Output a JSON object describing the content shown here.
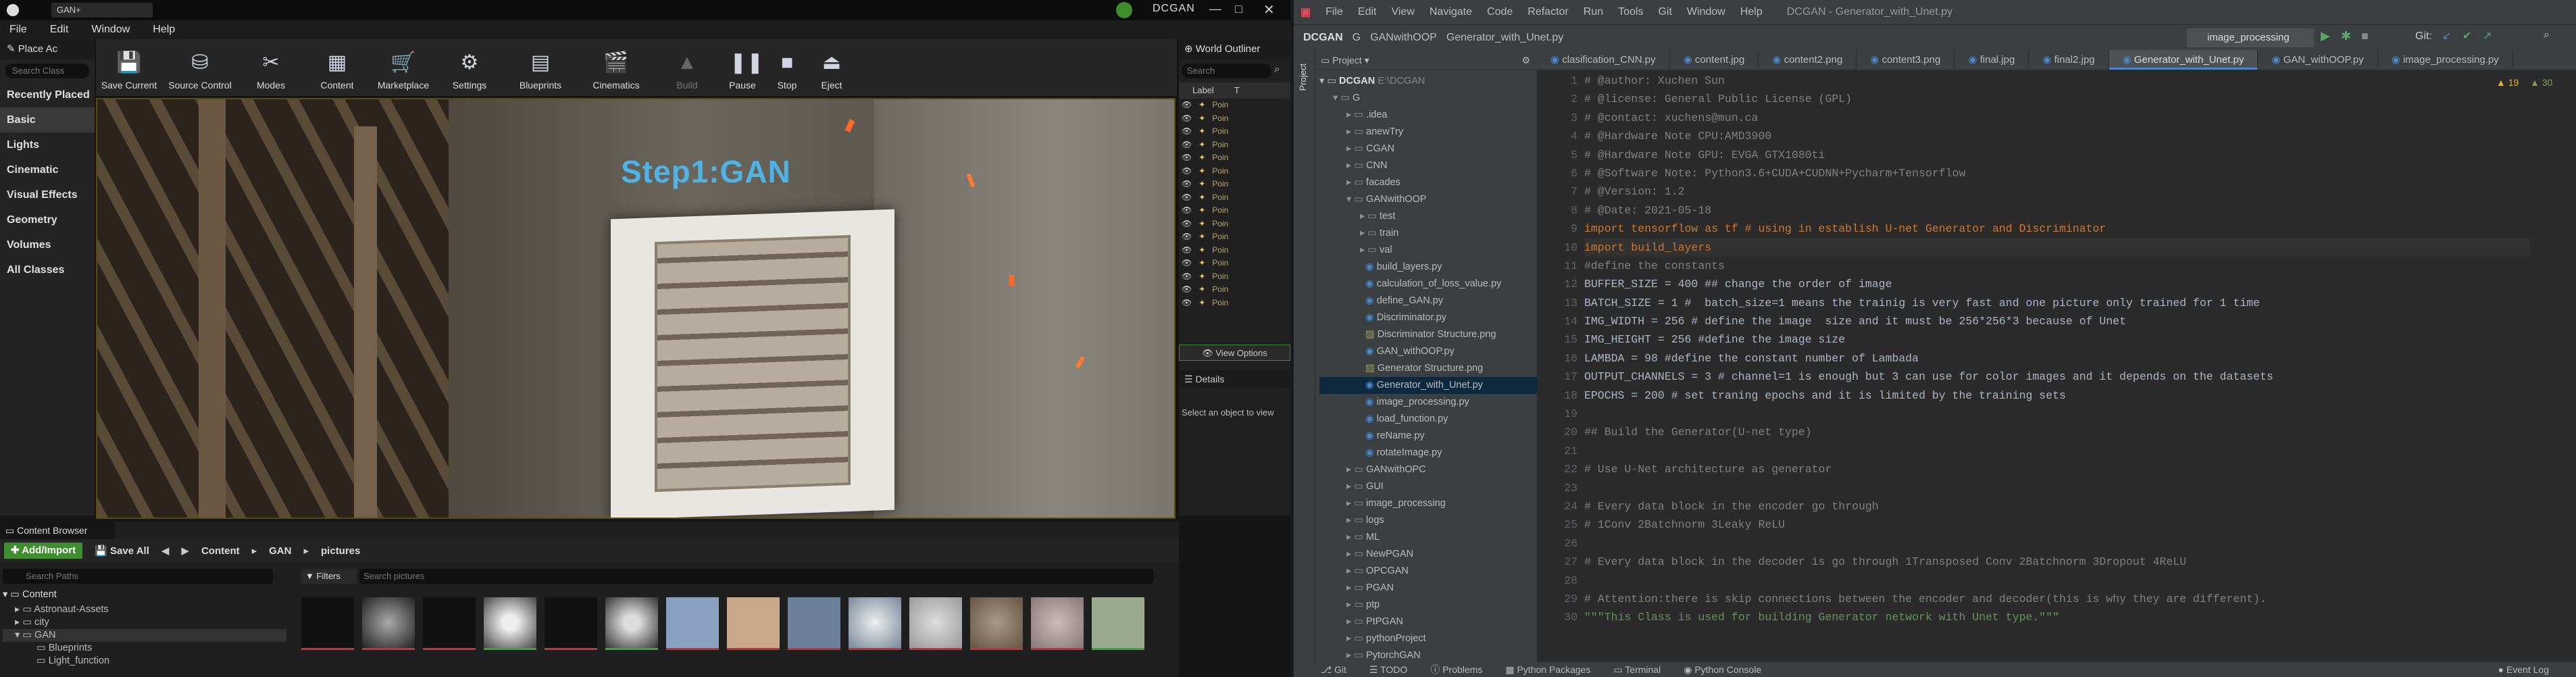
{
  "ue": {
    "window_title": "GAN+",
    "brand": "DCGAN",
    "menu": [
      "File",
      "Edit",
      "Window",
      "Help"
    ],
    "place_actors": "Place Ac",
    "search_classes": "Search Class",
    "categories": [
      "Recently Placed",
      "Basic",
      "Lights",
      "Cinematic",
      "Visual Effects",
      "Geometry",
      "Volumes",
      "All Classes"
    ],
    "toolbar": [
      "Save Current",
      "Source Control",
      "Modes",
      "Content",
      "Marketplace",
      "Settings",
      "Blueprints",
      "Cinematics",
      "Build",
      "Pause",
      "Stop",
      "Eject"
    ],
    "viewport_sign": "Step1:GAN",
    "outliner": {
      "title": "World Outliner",
      "search": "Search",
      "col_label": "Label",
      "col_type": "T",
      "rows": [
        "Poin",
        "Poin",
        "Poin",
        "Poin",
        "Poin",
        "Poin",
        "Poin",
        "Poin",
        "Poin",
        "Poin",
        "Poin",
        "Poin",
        "Poin",
        "Poin",
        "Poin",
        "Poin"
      ],
      "view_options": "View Options",
      "details": "Details",
      "details_hint": "Select an object to view"
    },
    "content_browser": {
      "tab": "Content Browser",
      "add_import": "Add/Import",
      "save_all": "Save All",
      "breadcrumb": [
        "Content",
        "GAN",
        "pictures"
      ],
      "search_paths": "Search Paths",
      "filters": "Filters",
      "search_pictures": "Search pictures",
      "tree": [
        "Content",
        "Astronaut-Assets",
        "city",
        "GAN",
        "Blueprints",
        "Light_function"
      ]
    }
  },
  "ide": {
    "menu": [
      "File",
      "Edit",
      "View",
      "Navigate",
      "Code",
      "Refactor",
      "Run",
      "Tools",
      "Git",
      "Window",
      "Help"
    ],
    "window_title": "DCGAN - Generator_with_Unet.py",
    "breadcrumb": [
      "DCGAN",
      "G",
      "GANwithOOP",
      "Generator_with_Unet.py"
    ],
    "run_config": "image_processing",
    "git_label": "Git:",
    "project_label": "Project",
    "project_root": "DCGAN",
    "project_root_path": "E:\\DCGAN",
    "tree": [
      {
        "indent": 1,
        "name": "G",
        "type": "folder",
        "open": true
      },
      {
        "indent": 2,
        "name": ".idea",
        "type": "folder"
      },
      {
        "indent": 2,
        "name": "anewTry",
        "type": "folder"
      },
      {
        "indent": 2,
        "name": "CGAN",
        "type": "folder"
      },
      {
        "indent": 2,
        "name": "CNN",
        "type": "folder"
      },
      {
        "indent": 2,
        "name": "facades",
        "type": "folder"
      },
      {
        "indent": 2,
        "name": "GANwithOOP",
        "type": "folder",
        "open": true
      },
      {
        "indent": 3,
        "name": "test",
        "type": "folder"
      },
      {
        "indent": 3,
        "name": "train",
        "type": "folder"
      },
      {
        "indent": 3,
        "name": "val",
        "type": "folder"
      },
      {
        "indent": 3,
        "name": "build_layers.py",
        "type": "py"
      },
      {
        "indent": 3,
        "name": "calculation_of_loss_value.py",
        "type": "py"
      },
      {
        "indent": 3,
        "name": "define_GAN.py",
        "type": "py"
      },
      {
        "indent": 3,
        "name": "Discriminator.py",
        "type": "py"
      },
      {
        "indent": 3,
        "name": "Discriminator Structure.png",
        "type": "png"
      },
      {
        "indent": 3,
        "name": "GAN_withOOP.py",
        "type": "py"
      },
      {
        "indent": 3,
        "name": "Generator Structure.png",
        "type": "png"
      },
      {
        "indent": 3,
        "name": "Generator_with_Unet.py",
        "type": "py",
        "selected": true
      },
      {
        "indent": 3,
        "name": "image_processing.py",
        "type": "py"
      },
      {
        "indent": 3,
        "name": "load_function.py",
        "type": "py"
      },
      {
        "indent": 3,
        "name": "reName.py",
        "type": "py"
      },
      {
        "indent": 3,
        "name": "rotateImage.py",
        "type": "py"
      },
      {
        "indent": 2,
        "name": "GANwithOPC",
        "type": "folder"
      },
      {
        "indent": 2,
        "name": "GUI",
        "type": "folder"
      },
      {
        "indent": 2,
        "name": "image_processing",
        "type": "folder"
      },
      {
        "indent": 2,
        "name": "logs",
        "type": "folder"
      },
      {
        "indent": 2,
        "name": "ML",
        "type": "folder"
      },
      {
        "indent": 2,
        "name": "NewPGAN",
        "type": "folder"
      },
      {
        "indent": 2,
        "name": "OPCGAN",
        "type": "folder"
      },
      {
        "indent": 2,
        "name": "PGAN",
        "type": "folder"
      },
      {
        "indent": 2,
        "name": "ptp",
        "type": "folder"
      },
      {
        "indent": 2,
        "name": "PtPGAN",
        "type": "folder"
      },
      {
        "indent": 2,
        "name": "pythonProject",
        "type": "folder"
      },
      {
        "indent": 2,
        "name": "PytorchGAN",
        "type": "folder"
      }
    ],
    "tabs": [
      "clasification_CNN.py",
      "content.jpg",
      "content2.png",
      "content3.png",
      "final.jpg",
      "final2.jpg",
      "Generator_with_Unet.py",
      "GAN_withOOP.py",
      "image_processing.py"
    ],
    "active_tab": "Generator_with_Unet.py",
    "warnings": "19",
    "weak": "30",
    "code": [
      {
        "n": "1",
        "t": "# @author: Xuchen Sun",
        "c": "cmt"
      },
      {
        "n": "2",
        "t": "# @license: General Public License (GPL)",
        "c": "cmt"
      },
      {
        "n": "3",
        "t": "# @contact: xuchens@mun.ca",
        "c": "cmt"
      },
      {
        "n": "4",
        "t": "# @Hardware Note CPU:AMD3900",
        "c": "cmt"
      },
      {
        "n": "5",
        "t": "# @Hardware Note GPU: EVGA GTX1080ti",
        "c": "cmt"
      },
      {
        "n": "6",
        "t": "# @Software Note: Python3.6+CUDA+CUDNN+Pycharm+Tensorflow",
        "c": "cmt"
      },
      {
        "n": "7",
        "t": "# @Version: 1.2",
        "c": "cmt"
      },
      {
        "n": "8",
        "t": "# @Date: 2021-05-18",
        "c": "cmt"
      },
      {
        "n": "9",
        "t": "import tensorflow as tf # using in establish U-net Generator and Discriminator",
        "c": "imp"
      },
      {
        "n": "10",
        "t": "import build_layers",
        "c": "imp"
      },
      {
        "n": "11",
        "t": "#define the constants",
        "c": "cmt"
      },
      {
        "n": "12",
        "t": "BUFFER_SIZE = 400 ## change the order of image",
        "c": "asg"
      },
      {
        "n": "13",
        "t": "BATCH_SIZE = 1 #  batch_size=1 means the trainig is very fast and one picture only trained for 1 time",
        "c": "asg"
      },
      {
        "n": "14",
        "t": "IMG_WIDTH = 256 # define the image  size and it must be 256*256*3 because of Unet",
        "c": "asg"
      },
      {
        "n": "15",
        "t": "IMG_HEIGHT = 256 #define the image size",
        "c": "asg"
      },
      {
        "n": "16",
        "t": "LAMBDA = 98 #define the constant number of Lambada",
        "c": "asg"
      },
      {
        "n": "17",
        "t": "OUTPUT_CHANNELS = 3 # channel=1 is enough but 3 can use for color images and it depends on the datasets",
        "c": "asg"
      },
      {
        "n": "18",
        "t": "EPOCHS = 200 # set traning epochs and it is limited by the training sets",
        "c": "asg"
      },
      {
        "n": "19",
        "t": "",
        "c": "cmt"
      },
      {
        "n": "20",
        "t": "## Build the Generator(U-net type)",
        "c": "cmt"
      },
      {
        "n": "21",
        "t": "",
        "c": "cmt"
      },
      {
        "n": "22",
        "t": "# Use U-Net architecture as generator",
        "c": "cmt"
      },
      {
        "n": "23",
        "t": "",
        "c": "cmt"
      },
      {
        "n": "24",
        "t": "# Every data block in the encoder go through",
        "c": "cmt"
      },
      {
        "n": "25",
        "t": "# 1Conv 2Batchnorm 3Leaky ReLU",
        "c": "cmt"
      },
      {
        "n": "26",
        "t": "",
        "c": "cmt"
      },
      {
        "n": "27",
        "t": "# Every data block in the decoder is go through 1Transposed Conv 2Batchnorm 3Dropout 4ReLU",
        "c": "cmt"
      },
      {
        "n": "28",
        "t": "",
        "c": "cmt"
      },
      {
        "n": "29",
        "t": "# Attention:there is skip connections between the encoder and decoder(this is why they are different).",
        "c": "cmt"
      },
      {
        "n": "30",
        "t": "\"\"\"This Class is used for building Generator network with Unet type.\"\"\"",
        "c": "str"
      }
    ],
    "status": [
      "Git",
      "TODO",
      "Problems",
      "Python Packages",
      "Terminal",
      "Python Console",
      "Event Log"
    ]
  },
  "colors": {
    "accent": "#4a88c7",
    "ue_green": "#3e8e2d",
    "comment": "#808080",
    "keyword": "#cc7832",
    "number": "#6897bb",
    "string": "#6a8759"
  }
}
